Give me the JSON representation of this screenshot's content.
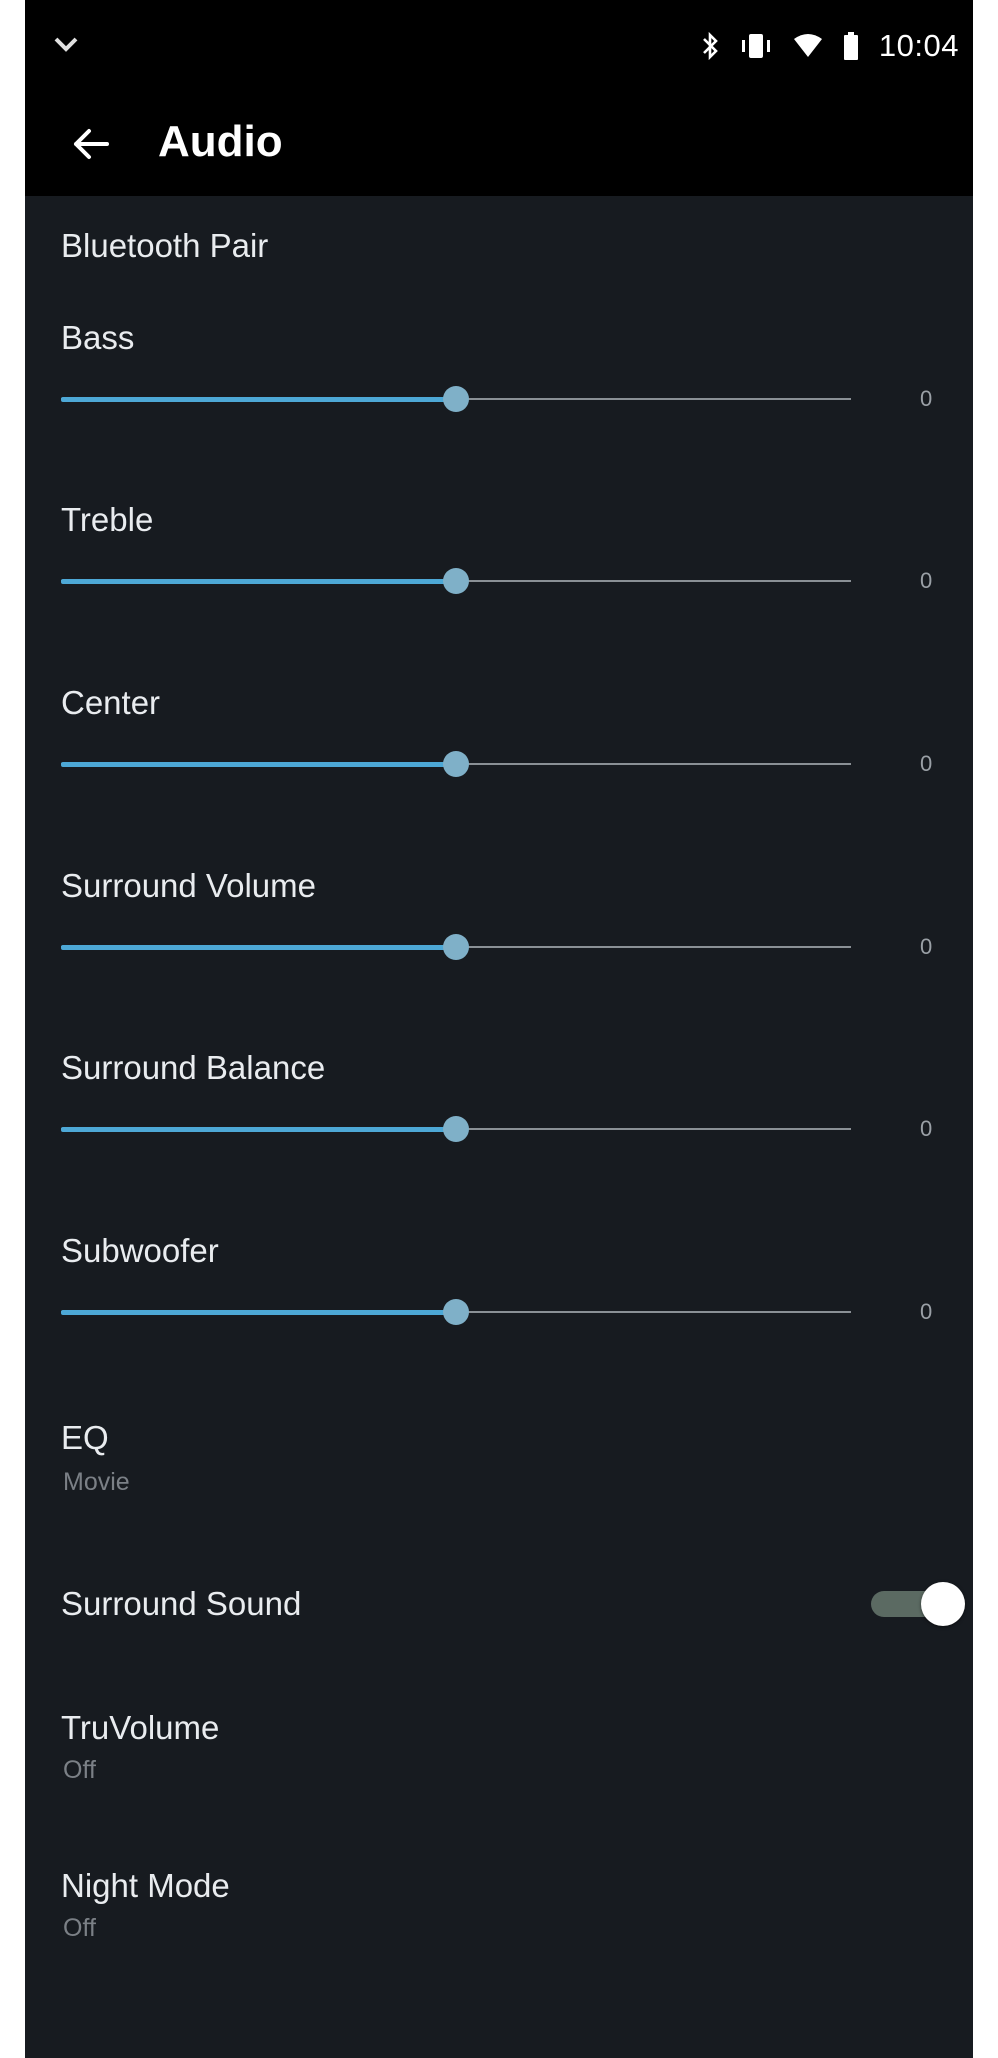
{
  "status_bar": {
    "time": "10:04",
    "icons": [
      "notification-chevron-icon",
      "bluetooth-icon",
      "vibrate-icon",
      "wifi-icon",
      "battery-icon"
    ]
  },
  "app_bar": {
    "back_icon": "arrow-left-icon",
    "title": "Audio"
  },
  "settings": {
    "bluetooth_pair": {
      "label": "Bluetooth Pair"
    },
    "sliders": [
      {
        "label": "Bass",
        "value": "0",
        "level": 0.5
      },
      {
        "label": "Treble",
        "value": "0",
        "level": 0.5
      },
      {
        "label": "Center",
        "value": "0",
        "level": 0.5
      },
      {
        "label": "Surround Volume",
        "value": "0",
        "level": 0.5
      },
      {
        "label": "Surround Balance",
        "value": "0",
        "level": 0.5
      },
      {
        "label": "Subwoofer",
        "value": "0",
        "level": 0.5
      }
    ],
    "eq": {
      "label": "EQ",
      "value": "Movie"
    },
    "surround_sound": {
      "label": "Surround Sound",
      "on": true
    },
    "truvolume": {
      "label": "TruVolume",
      "value": "Off"
    },
    "night_mode": {
      "label": "Night Mode",
      "value": "Off"
    }
  },
  "colors": {
    "background": "#171b20",
    "app_bar": "#000000",
    "accent": "#4da8d6",
    "text_primary": "#e9ecef",
    "text_secondary": "#7b8086"
  }
}
